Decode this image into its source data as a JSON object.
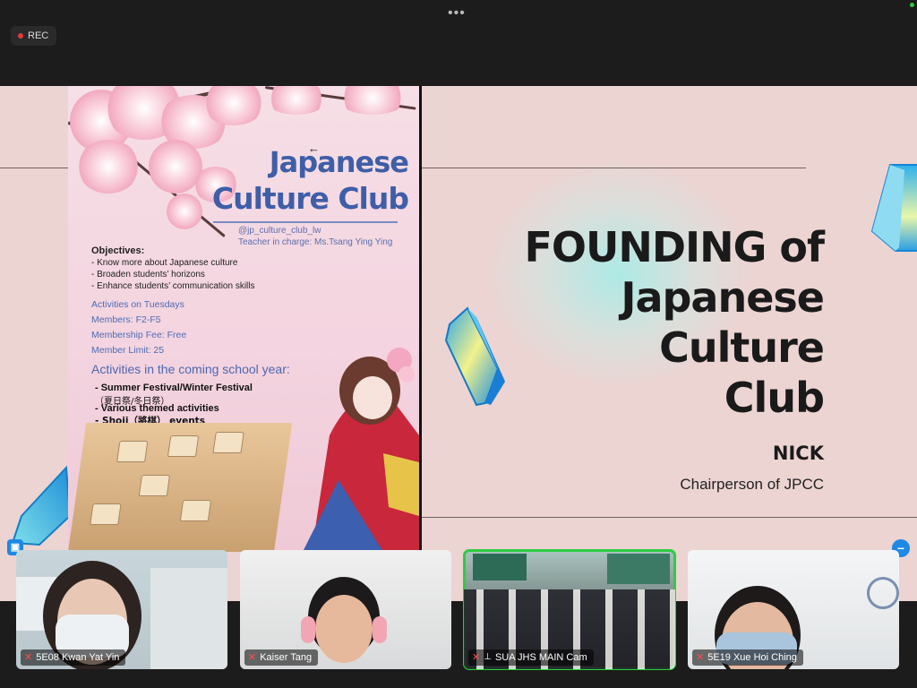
{
  "window": {
    "rec_label": "REC",
    "more_label": "•••"
  },
  "slide": {
    "poster": {
      "title_line1": "Japanese",
      "title_line2": "Culture Club",
      "handle": "@jp_culture_club_lw",
      "teacher": "Teacher in charge: Ms.Tsang Ying Ying",
      "objectives_heading": "Objectives:",
      "objectives": [
        "- Know more about Japanese culture",
        "- Broaden students’ horizons",
        "- Enhance students’ communication skills"
      ],
      "info": [
        "Activities on Tuesdays",
        "Members: F2-F5",
        "Membership Fee: Free",
        "Member Limit: 25"
      ],
      "activities_heading": "Activities in the coming school year:",
      "activities": [
        "- Summer Festival/Winter Festival",
        "（夏日祭/冬日祭）",
        "- Various themed activities",
        "- Shoji（將棋） events"
      ]
    },
    "headline_lines": [
      "FOUNDING of",
      "Japanese",
      "Culture",
      "Club"
    ],
    "presenter_name": "NICK",
    "presenter_role": "Chairperson of JPCC",
    "colors": {
      "background": "#ecd4d2",
      "poster_title": "#3f5ea8",
      "active_speaker": "#2ecc40"
    }
  },
  "participants": [
    {
      "name": "5E08 Kwan Yat Yin",
      "muted": true,
      "pinned": false,
      "active": false
    },
    {
      "name": "Kaiser Tang",
      "muted": true,
      "pinned": false,
      "active": false
    },
    {
      "name": "SUA JHS  MAIN Cam",
      "muted": true,
      "pinned": true,
      "active": true
    },
    {
      "name": "5E19 Xue Hoi Ching",
      "muted": true,
      "pinned": false,
      "active": false
    }
  ],
  "icons": [
    "record-dot-icon",
    "more-icon",
    "cursor-arrow-icon",
    "muted-mic-icon",
    "pin-icon",
    "person-card-icon",
    "minus-icon"
  ]
}
